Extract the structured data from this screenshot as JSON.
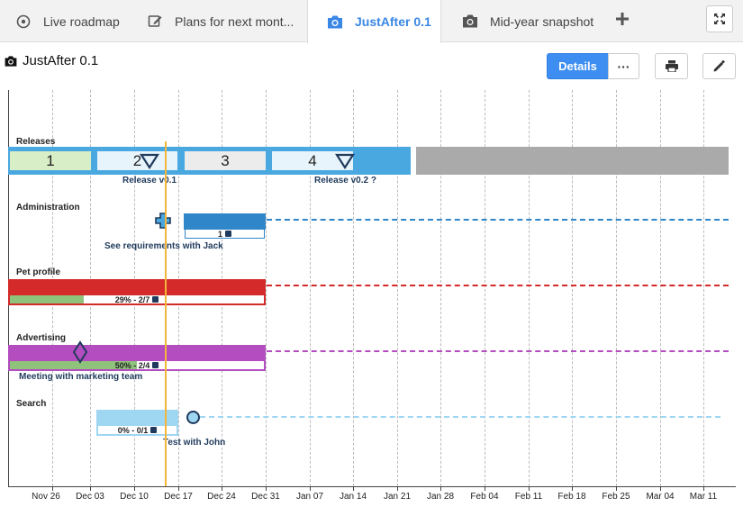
{
  "tabs": [
    {
      "label": "Live roadmap",
      "icon": "compass-icon"
    },
    {
      "label": "Plans for next mont...",
      "icon": "edit-icon"
    },
    {
      "label": "JustAfter 0.1",
      "icon": "camera-icon"
    },
    {
      "label": "Mid-year snapshot",
      "icon": "camera-icon"
    }
  ],
  "header": {
    "title": "JustAfter 0.1",
    "details_label": "Details",
    "more_label": "···"
  },
  "timeline": {
    "ticks": [
      "Nov 26",
      "Dec 03",
      "Dec 10",
      "Dec 17",
      "Dec 24",
      "Dec 31",
      "Jan 07",
      "Jan 14",
      "Jan 21",
      "Jan 28",
      "Feb 04",
      "Feb 11",
      "Feb 18",
      "Feb 25",
      "Mar 04",
      "Mar 11"
    ],
    "releases": {
      "label": "Releases",
      "sprints": [
        "1",
        "2",
        "3",
        "4"
      ],
      "milestones": [
        "Release v0.1",
        "Release v0.2 ?"
      ]
    },
    "lanes": [
      {
        "label": "Administration",
        "progress": "1",
        "marker": "See requirements with Jack",
        "color": "#2f86c8"
      },
      {
        "label": "Pet profile",
        "progress": "29% - 2/7",
        "fraction": 0.29,
        "color": "#d42a2a"
      },
      {
        "label": "Advertising",
        "progress": "50% - 2/4",
        "fraction": 0.5,
        "marker": "Meeting with marketing team",
        "color": "#b34dc0"
      },
      {
        "label": "Search",
        "progress": "0% - 0/1",
        "fraction": 0,
        "marker": "Test with John",
        "color": "#9fd6f2"
      }
    ],
    "progress_color": "#8fc27a"
  }
}
